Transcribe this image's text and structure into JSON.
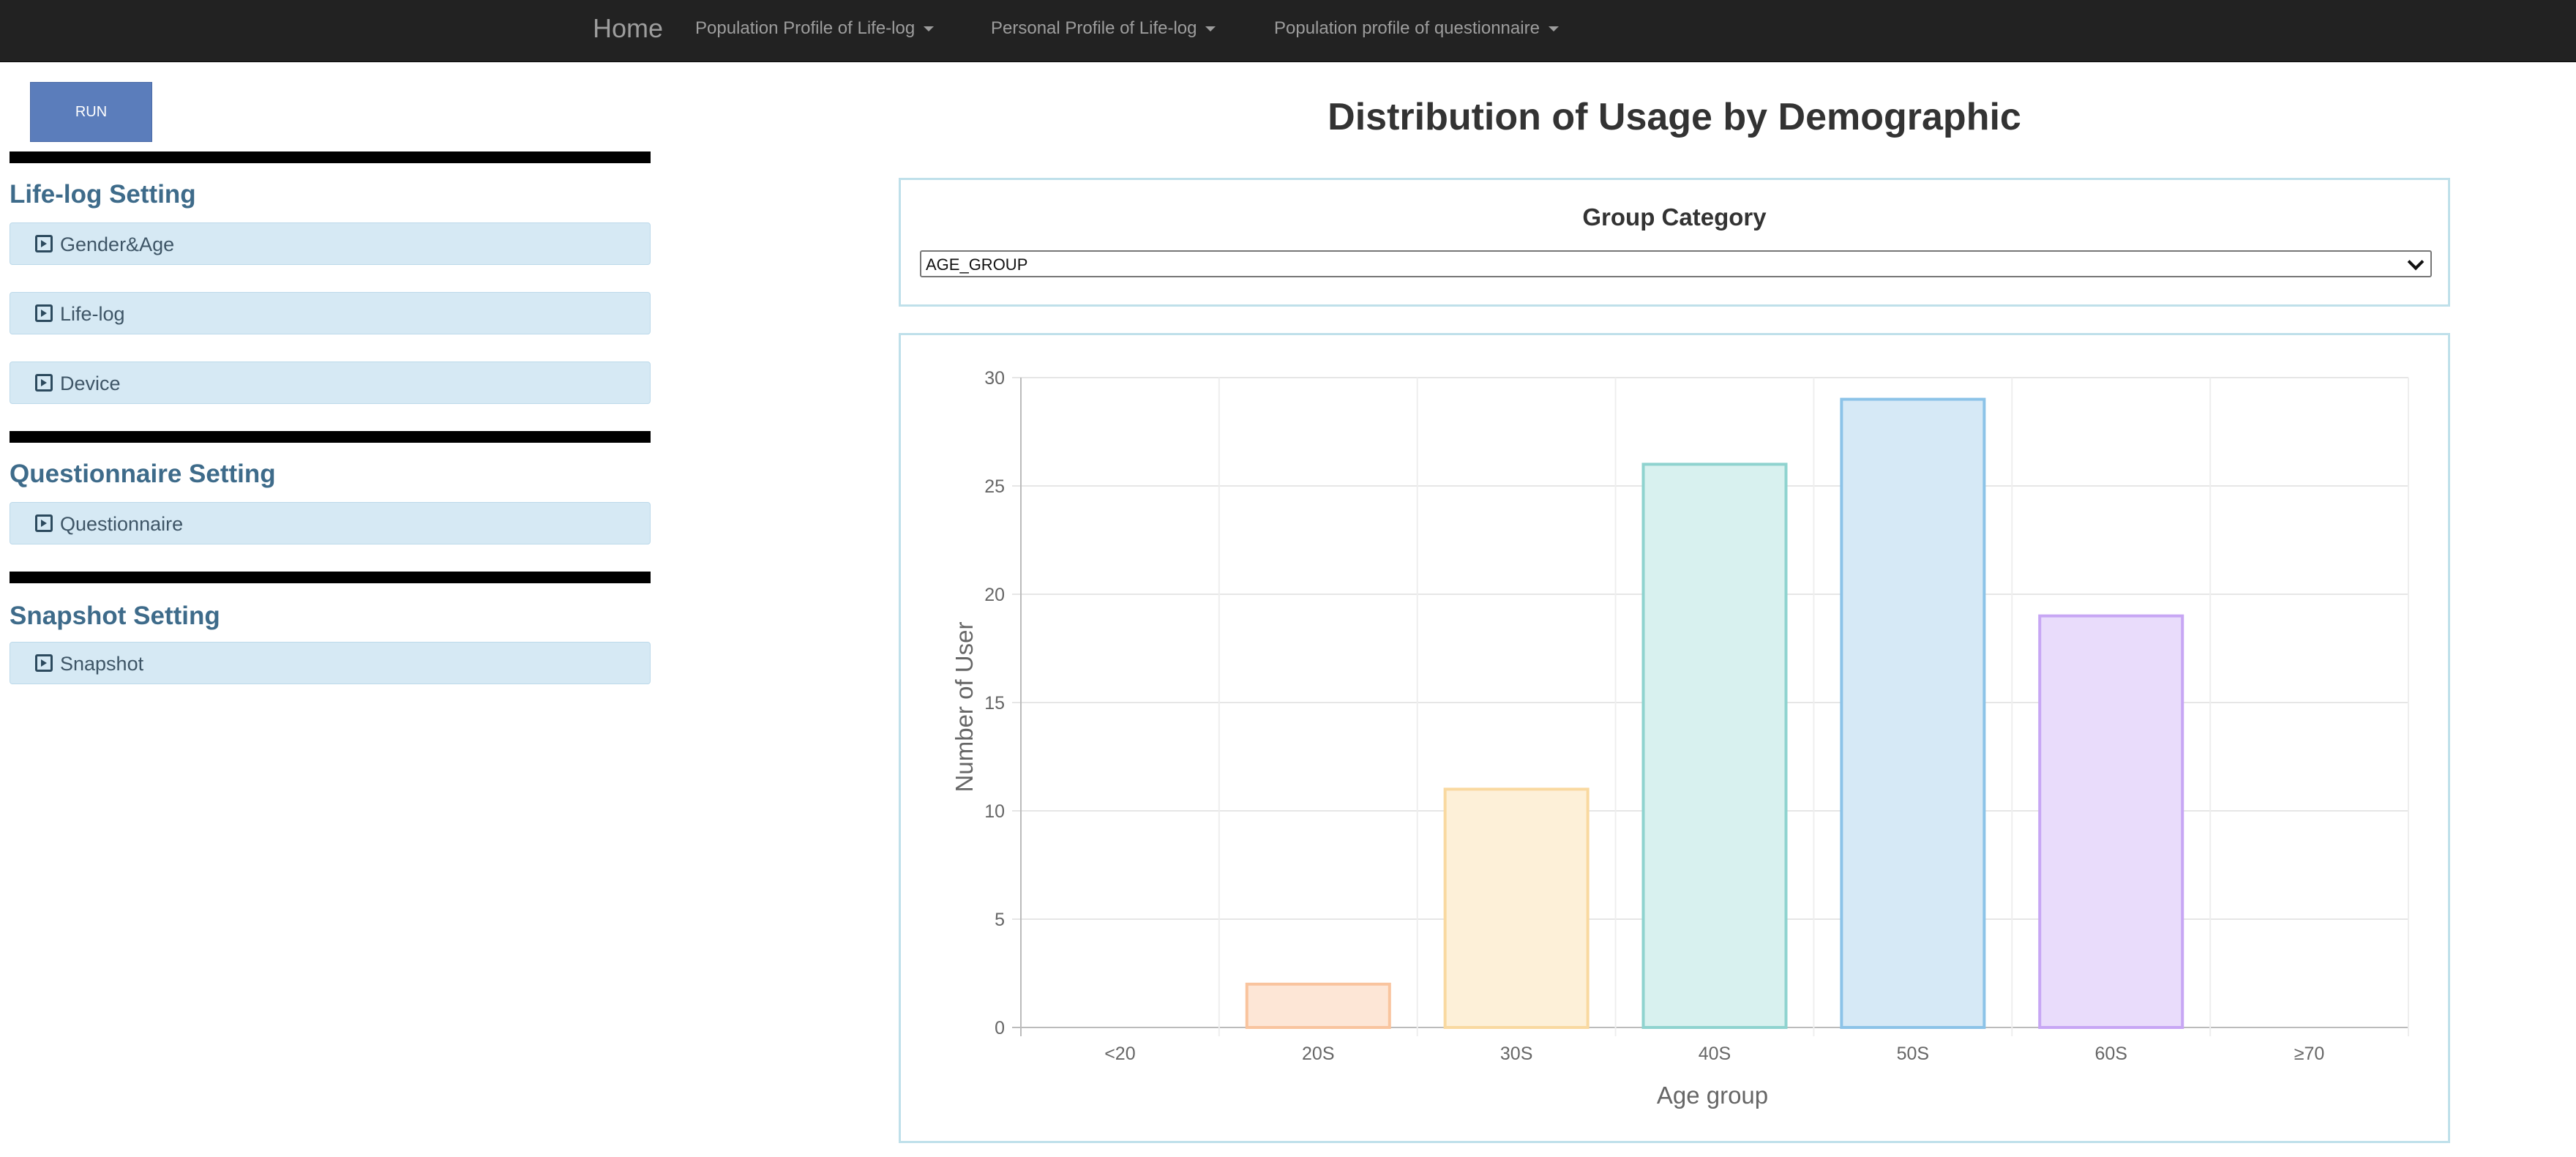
{
  "nav": {
    "brand": "Home",
    "items": [
      {
        "label": "Population Profile of Life-log"
      },
      {
        "label": "Personal Profile of Life-log"
      },
      {
        "label": "Population profile of questionnaire"
      }
    ]
  },
  "sidebar": {
    "run_label": "RUN",
    "sections": [
      {
        "title": "Life-log Setting",
        "buttons": [
          "Gender&Age",
          "Life-log",
          "Device"
        ]
      },
      {
        "title": "Questionnaire Setting",
        "buttons": [
          "Questionnaire"
        ]
      },
      {
        "title": "Snapshot Setting",
        "buttons": [
          "Snapshot"
        ]
      }
    ]
  },
  "main": {
    "title": "Distribution of Usage by Demographic",
    "group_category_label": "Group Category",
    "group_category_value": "AGE_GROUP"
  },
  "colors": {
    "navbar": "#222222",
    "accent_title": "#3e6b8a",
    "panel_border": "#bfe0ea",
    "run_button": "#5b7dbb"
  },
  "chart_data": {
    "type": "bar",
    "xlabel": "Age group",
    "ylabel": "Number of User",
    "ylim": [
      0,
      30
    ],
    "yticks": [
      0,
      5,
      10,
      15,
      20,
      25,
      30
    ],
    "grid": true,
    "categories": [
      "<20",
      "20S",
      "30S",
      "40S",
      "50S",
      "60S",
      "≥70"
    ],
    "values": [
      0,
      2,
      11,
      26,
      29,
      19,
      0
    ],
    "bar_fill": [
      "#ffdfe6",
      "#fde6d6",
      "#fdf0d8",
      "#d8f1ef",
      "#d6e9f6",
      "#e9dcfb",
      "#eeeeee"
    ],
    "bar_stroke": [
      "#ff9fb5",
      "#f9c49e",
      "#f9d9a0",
      "#8fd3cf",
      "#8cc3e8",
      "#c7a6f4",
      "#cfcfcf"
    ]
  }
}
